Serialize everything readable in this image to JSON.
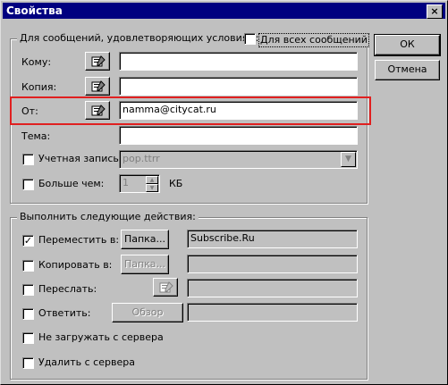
{
  "window": {
    "title": "Свойства",
    "close_glyph": "×"
  },
  "conditions": {
    "legend": "Для сообщений, удовлетворяющих условиям:",
    "all_messages_label": "Для всех сообщений",
    "all_messages_checked": false,
    "to_label": "Кому:",
    "to_value": "",
    "cc_label": "Копия:",
    "cc_value": "",
    "from_label": "От:",
    "from_value": "namma@citycat.ru",
    "subject_label": "Тема:",
    "subject_value": "",
    "account_label": "Учетная запись:",
    "account_value": "pop.ttrr",
    "account_checked": false,
    "larger_label": "Больше чем:",
    "larger_value": "1",
    "larger_unit": "КБ",
    "larger_checked": false
  },
  "actions": {
    "legend": "Выполнить следующие действия:",
    "move_label": "Переместить в:",
    "move_checked": true,
    "move_button": "Папка...",
    "move_value": "Subscribe.Ru",
    "copy_label": "Копировать в:",
    "copy_checked": false,
    "copy_button": "Папка...",
    "copy_value": "",
    "forward_label": "Переслать:",
    "forward_checked": false,
    "forward_value": "",
    "reply_label": "Ответить:",
    "reply_checked": false,
    "reply_button": "Обзор",
    "reply_value": "",
    "no_download_label": "Не загружать с сервера",
    "no_download_checked": false,
    "delete_label": "Удалить с сервера",
    "delete_checked": false
  },
  "buttons": {
    "ok": "ОК",
    "cancel": "Отмена"
  },
  "colors": {
    "titlebar": "#000080",
    "highlight": "#e02020",
    "face": "#c0c0c0"
  },
  "icons": {
    "address_book": "address-book-icon",
    "check": "checkmark-icon"
  }
}
